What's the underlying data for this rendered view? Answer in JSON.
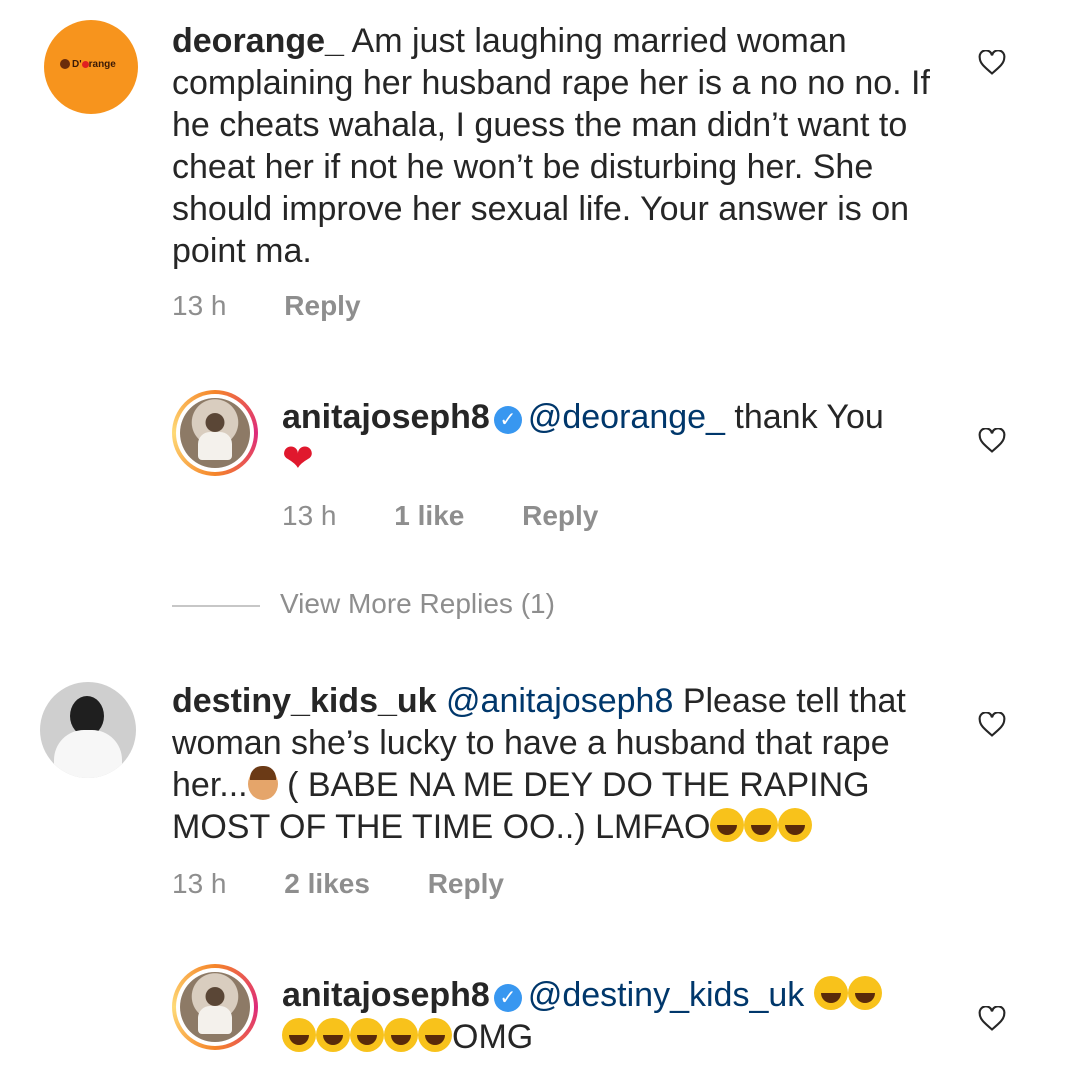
{
  "comments": [
    {
      "username": "deorange_",
      "text": "Am just laughing married woman complaining her husband rape her is a no no no. If he cheats wahala, I guess the man didn’t want to cheat her if not he won’t be disturbing her. She should improve her sexual life. Your answer is on point ma.",
      "time": "13 h",
      "reply_label": "Reply",
      "avatar_logo": "D'Orange"
    },
    {
      "username": "anitajoseph8",
      "mention": "@deorange_",
      "text": "thank You",
      "time": "13 h",
      "likes": "1 like",
      "reply_label": "Reply"
    },
    {
      "username": "destiny_kids_uk",
      "mention": "@anitajoseph8",
      "text_a": "Please tell that woman she’s lucky to have a husband that rape her...",
      "text_b": "( BABE NA ME DEY DO THE RAPING MOST OF THE TIME OO..) LMFAO",
      "time": "13 h",
      "likes": "2 likes",
      "reply_label": "Reply"
    },
    {
      "username": "anitajoseph8",
      "mention": "@destiny_kids_uk",
      "text": "OMG"
    }
  ],
  "view_more": "View More Replies (1)",
  "icons": {
    "like": "heart-outline-icon",
    "verified": "verified-badge-icon",
    "emoji": "rolling-on-floor-laughing-emoji"
  },
  "colors": {
    "mention": "#00376b",
    "meta": "#8e8e8e",
    "verified": "#3897f0",
    "heart": "#e0182d"
  }
}
